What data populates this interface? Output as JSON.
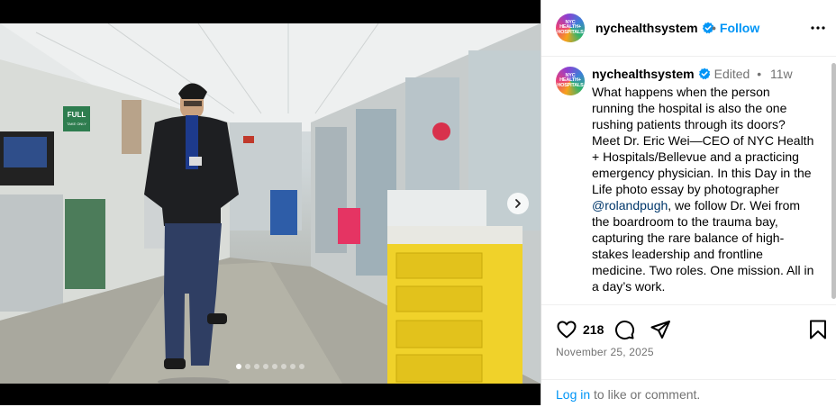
{
  "post": {
    "username": "nychealthsystem",
    "avatar_text": "NYC HEALTH+ HOSPITALS",
    "follow_label": "Follow",
    "separator": "•"
  },
  "media": {
    "slide_count": 8,
    "active_slide": 1,
    "wall_sign": "FULL",
    "wall_sign_sub": "TAKE ONLY"
  },
  "caption": {
    "username": "nychealthsystem",
    "edited": "Edited",
    "separator": "•",
    "time": "11w",
    "text_before": "What happens when the person running the hospital is also the one rushing patients through its doors? Meet Dr. Eric Wei—CEO of NYC Health + Hospitals/Bellevue and a practicing emergency physician. In this Day in the Life photo essay by photographer ",
    "mention": "@rolandpugh",
    "text_after": ", we follow Dr. Wei from the boardroom to the trauma bay, capturing the rare balance of high-stakes leadership and frontline medicine. Two roles. One mission. All in a day’s work."
  },
  "actions": {
    "likes": "218",
    "date": "November 25, 2025"
  },
  "login": {
    "link": "Log in",
    "rest": " to like or comment."
  },
  "colors": {
    "accent": "#0095f6",
    "mention": "#00376b",
    "secondary_text": "#737373",
    "verified": "#0095f6"
  },
  "icons": {
    "verified": "verified-badge-icon",
    "more": "more-options-icon",
    "next": "chevron-right-icon",
    "like": "heart-icon",
    "comment": "comment-icon",
    "share": "share-icon",
    "save": "bookmark-icon"
  }
}
